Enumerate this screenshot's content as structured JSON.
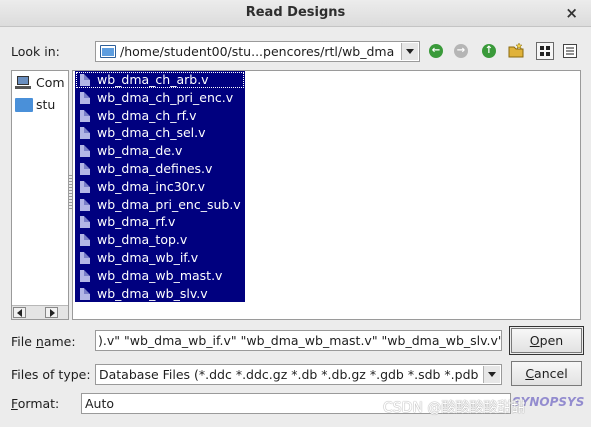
{
  "dialog": {
    "title": "Read Designs",
    "close_glyph": "×"
  },
  "look_in": {
    "label_pre": "Look in:",
    "path": "/home/student00/stu...pencores/rtl/wb_dma",
    "icon": "folder-icon"
  },
  "toolbar": {
    "back_icon": "back-arrow-icon",
    "forward_icon": "forward-arrow-icon",
    "up_icon": "parent-directory-icon",
    "new_folder_icon": "new-folder-icon",
    "list_view_icon": "list-view-icon",
    "detail_view_icon": "detail-view-icon",
    "colors": {
      "back": "#3a9a3a",
      "forward": "#b5b5b5",
      "up": "#3a9a3a"
    }
  },
  "sidebar": {
    "items": [
      {
        "label": "Com",
        "icon": "computer-icon"
      },
      {
        "label": "stu",
        "icon": "folder-icon"
      }
    ]
  },
  "files": [
    "wb_dma_ch_arb.v",
    "wb_dma_ch_pri_enc.v",
    "wb_dma_ch_rf.v",
    "wb_dma_ch_sel.v",
    "wb_dma_de.v",
    "wb_dma_defines.v",
    "wb_dma_inc30r.v",
    "wb_dma_pri_enc_sub.v",
    "wb_dma_rf.v",
    "wb_dma_top.v",
    "wb_dma_wb_if.v",
    "wb_dma_wb_mast.v",
    "wb_dma_wb_slv.v"
  ],
  "file_name": {
    "label_pre": "File ",
    "label_ul": "n",
    "label_post": "ame:",
    "value": ").v\" \"wb_dma_wb_if.v\" \"wb_dma_wb_mast.v\" \"wb_dma_wb_slv.v\""
  },
  "file_type": {
    "label": "Files of type:",
    "value": "Database Files (*.ddc *.ddc.gz *.db *.db.gz *.gdb *.sdb *.pdb"
  },
  "format": {
    "label_ul": "F",
    "label_post": "ormat:",
    "value": "Auto"
  },
  "buttons": {
    "open_ul": "O",
    "open_post": "pen",
    "cancel_ul": "C",
    "cancel_post": "ancel"
  },
  "watermark": "CSDN @酸酸酸酸甜甜",
  "logo_text": "SYNOPSYS"
}
